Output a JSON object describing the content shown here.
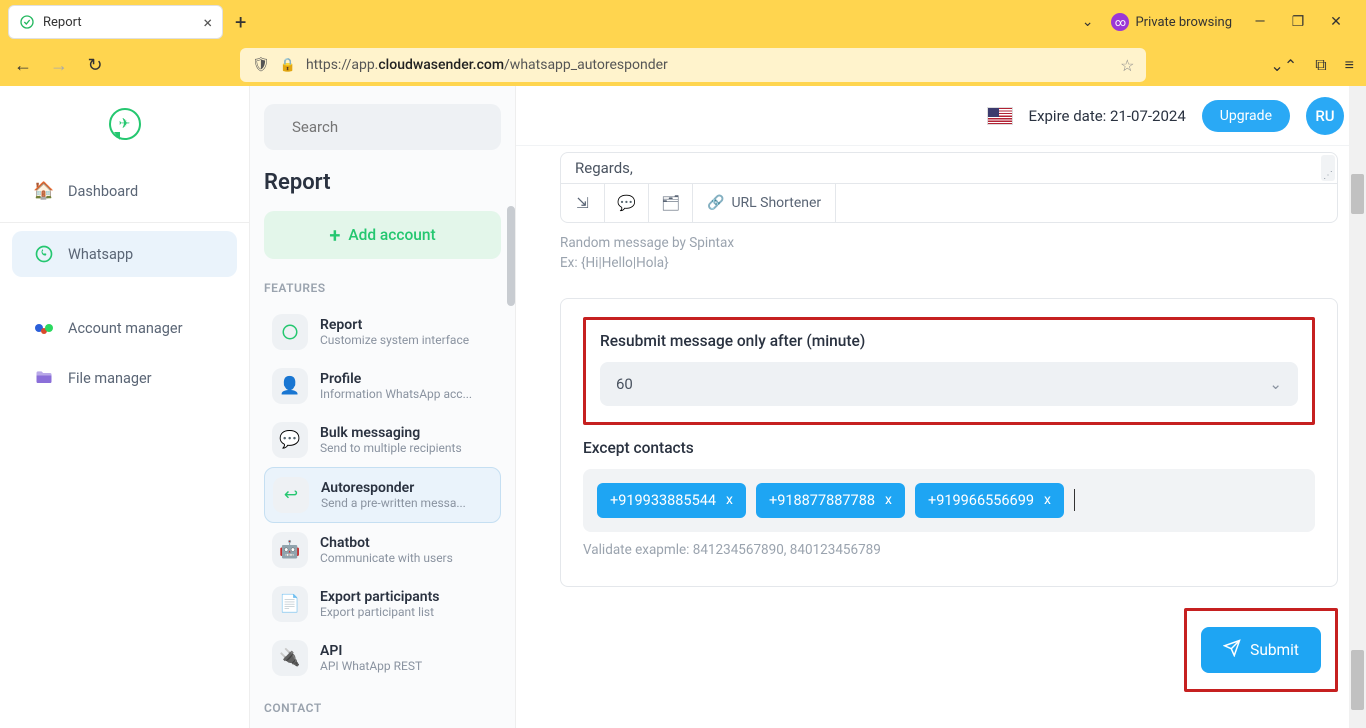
{
  "browser": {
    "tab_title": "Report",
    "private_label": "Private browsing",
    "url_prefix": "https://app.",
    "url_domain": "cloudwasender.com",
    "url_path": "/whatsapp_autoresponder"
  },
  "left_nav": {
    "dashboard": "Dashboard",
    "whatsapp": "Whatsapp",
    "account_manager": "Account manager",
    "file_manager": "File manager"
  },
  "panel": {
    "search_placeholder": "Search",
    "title": "Report",
    "add_account": "Add account",
    "features_label": "FEATURES",
    "contact_label": "CONTACT",
    "items": [
      {
        "name": "Report",
        "desc": "Customize system interface"
      },
      {
        "name": "Profile",
        "desc": "Information WhatsApp acc..."
      },
      {
        "name": "Bulk messaging",
        "desc": "Send to multiple recipients"
      },
      {
        "name": "Autoresponder",
        "desc": "Send a pre-written messa..."
      },
      {
        "name": "Chatbot",
        "desc": "Communicate with users"
      },
      {
        "name": "Export participants",
        "desc": "Export participant list"
      },
      {
        "name": "API",
        "desc": "API WhatApp REST"
      }
    ]
  },
  "topbar": {
    "expire": "Expire date: 21-07-2024",
    "upgrade": "Upgrade",
    "avatar": "RU"
  },
  "editor": {
    "body": "Regards,",
    "url_shortener": "URL Shortener",
    "hint1": "Random message by Spintax",
    "hint2": "Ex: {Hi|Hello|Hola}"
  },
  "form": {
    "resubmit_label": "Resubmit message only after (minute)",
    "resubmit_value": "60",
    "except_label": "Except contacts",
    "chips": [
      "+919933885544",
      "+918877887788",
      "+919966556699"
    ],
    "chip_close": "x",
    "validate_hint": "Validate exapmle: 841234567890, 840123456789",
    "submit": "Submit"
  }
}
